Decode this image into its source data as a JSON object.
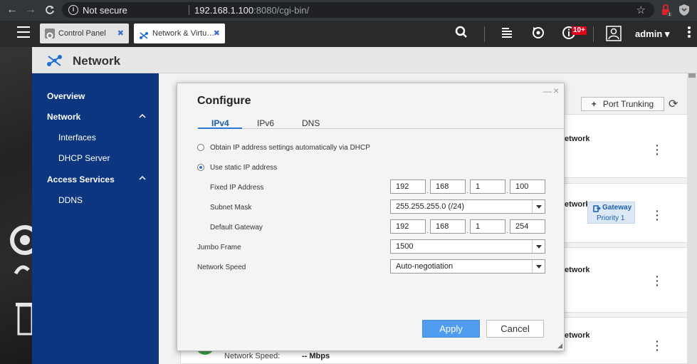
{
  "browser": {
    "info_icon": "info-icon",
    "security_label": "Not secure",
    "url_host": "192.168.1.100",
    "url_rest": ":8080/cgi-bin/"
  },
  "appbar": {
    "tabs": [
      {
        "label": "Control Panel",
        "close": "✖"
      },
      {
        "label": "Network & Virtu…",
        "close": "✖"
      }
    ],
    "notification_badge": "10+",
    "user": "admin ▾"
  },
  "network_app": {
    "title": "Network",
    "sidebar": {
      "overview": "Overview",
      "network": "Network",
      "interfaces": "Interfaces",
      "dhcp_server": "DHCP Server",
      "access_services": "Access Services",
      "ddns": "DDNS"
    },
    "toolbar": {
      "port_trunking": "Port Trunking",
      "port_trunking_icon": "+"
    },
    "cards": [
      {
        "label": "letwork"
      },
      {
        "label": "letwork"
      },
      {
        "label": "letwork"
      },
      {
        "label": "letwork"
      }
    ],
    "gateway_badge": {
      "label": "Gateway",
      "priority": "Priority 1"
    },
    "footer": {
      "speed_label": "Network Speed:",
      "speed_value": "-- Mbps"
    }
  },
  "dialog": {
    "title": "Configure",
    "tabs": [
      "IPv4",
      "IPv6",
      "DNS"
    ],
    "active_tab": "IPv4",
    "options": {
      "dhcp": "Obtain IP address settings automatically via DHCP",
      "static": "Use static IP address"
    },
    "selected_option": "static",
    "fields": {
      "fixed_ip_label": "Fixed IP Address",
      "fixed_ip": [
        "192",
        "168",
        "1",
        "100"
      ],
      "subnet_label": "Subnet Mask",
      "subnet_value": "255.255.255.0 (/24)",
      "gateway_label": "Default Gateway",
      "gateway": [
        "192",
        "168",
        "1",
        "254"
      ],
      "jumbo_label": "Jumbo Frame",
      "jumbo_value": "1500",
      "speed_label": "Network Speed",
      "speed_value": "Auto-negotiation"
    },
    "buttons": {
      "apply": "Apply",
      "cancel": "Cancel"
    },
    "window_controls": {
      "minimize": "—",
      "close": "×"
    }
  }
}
